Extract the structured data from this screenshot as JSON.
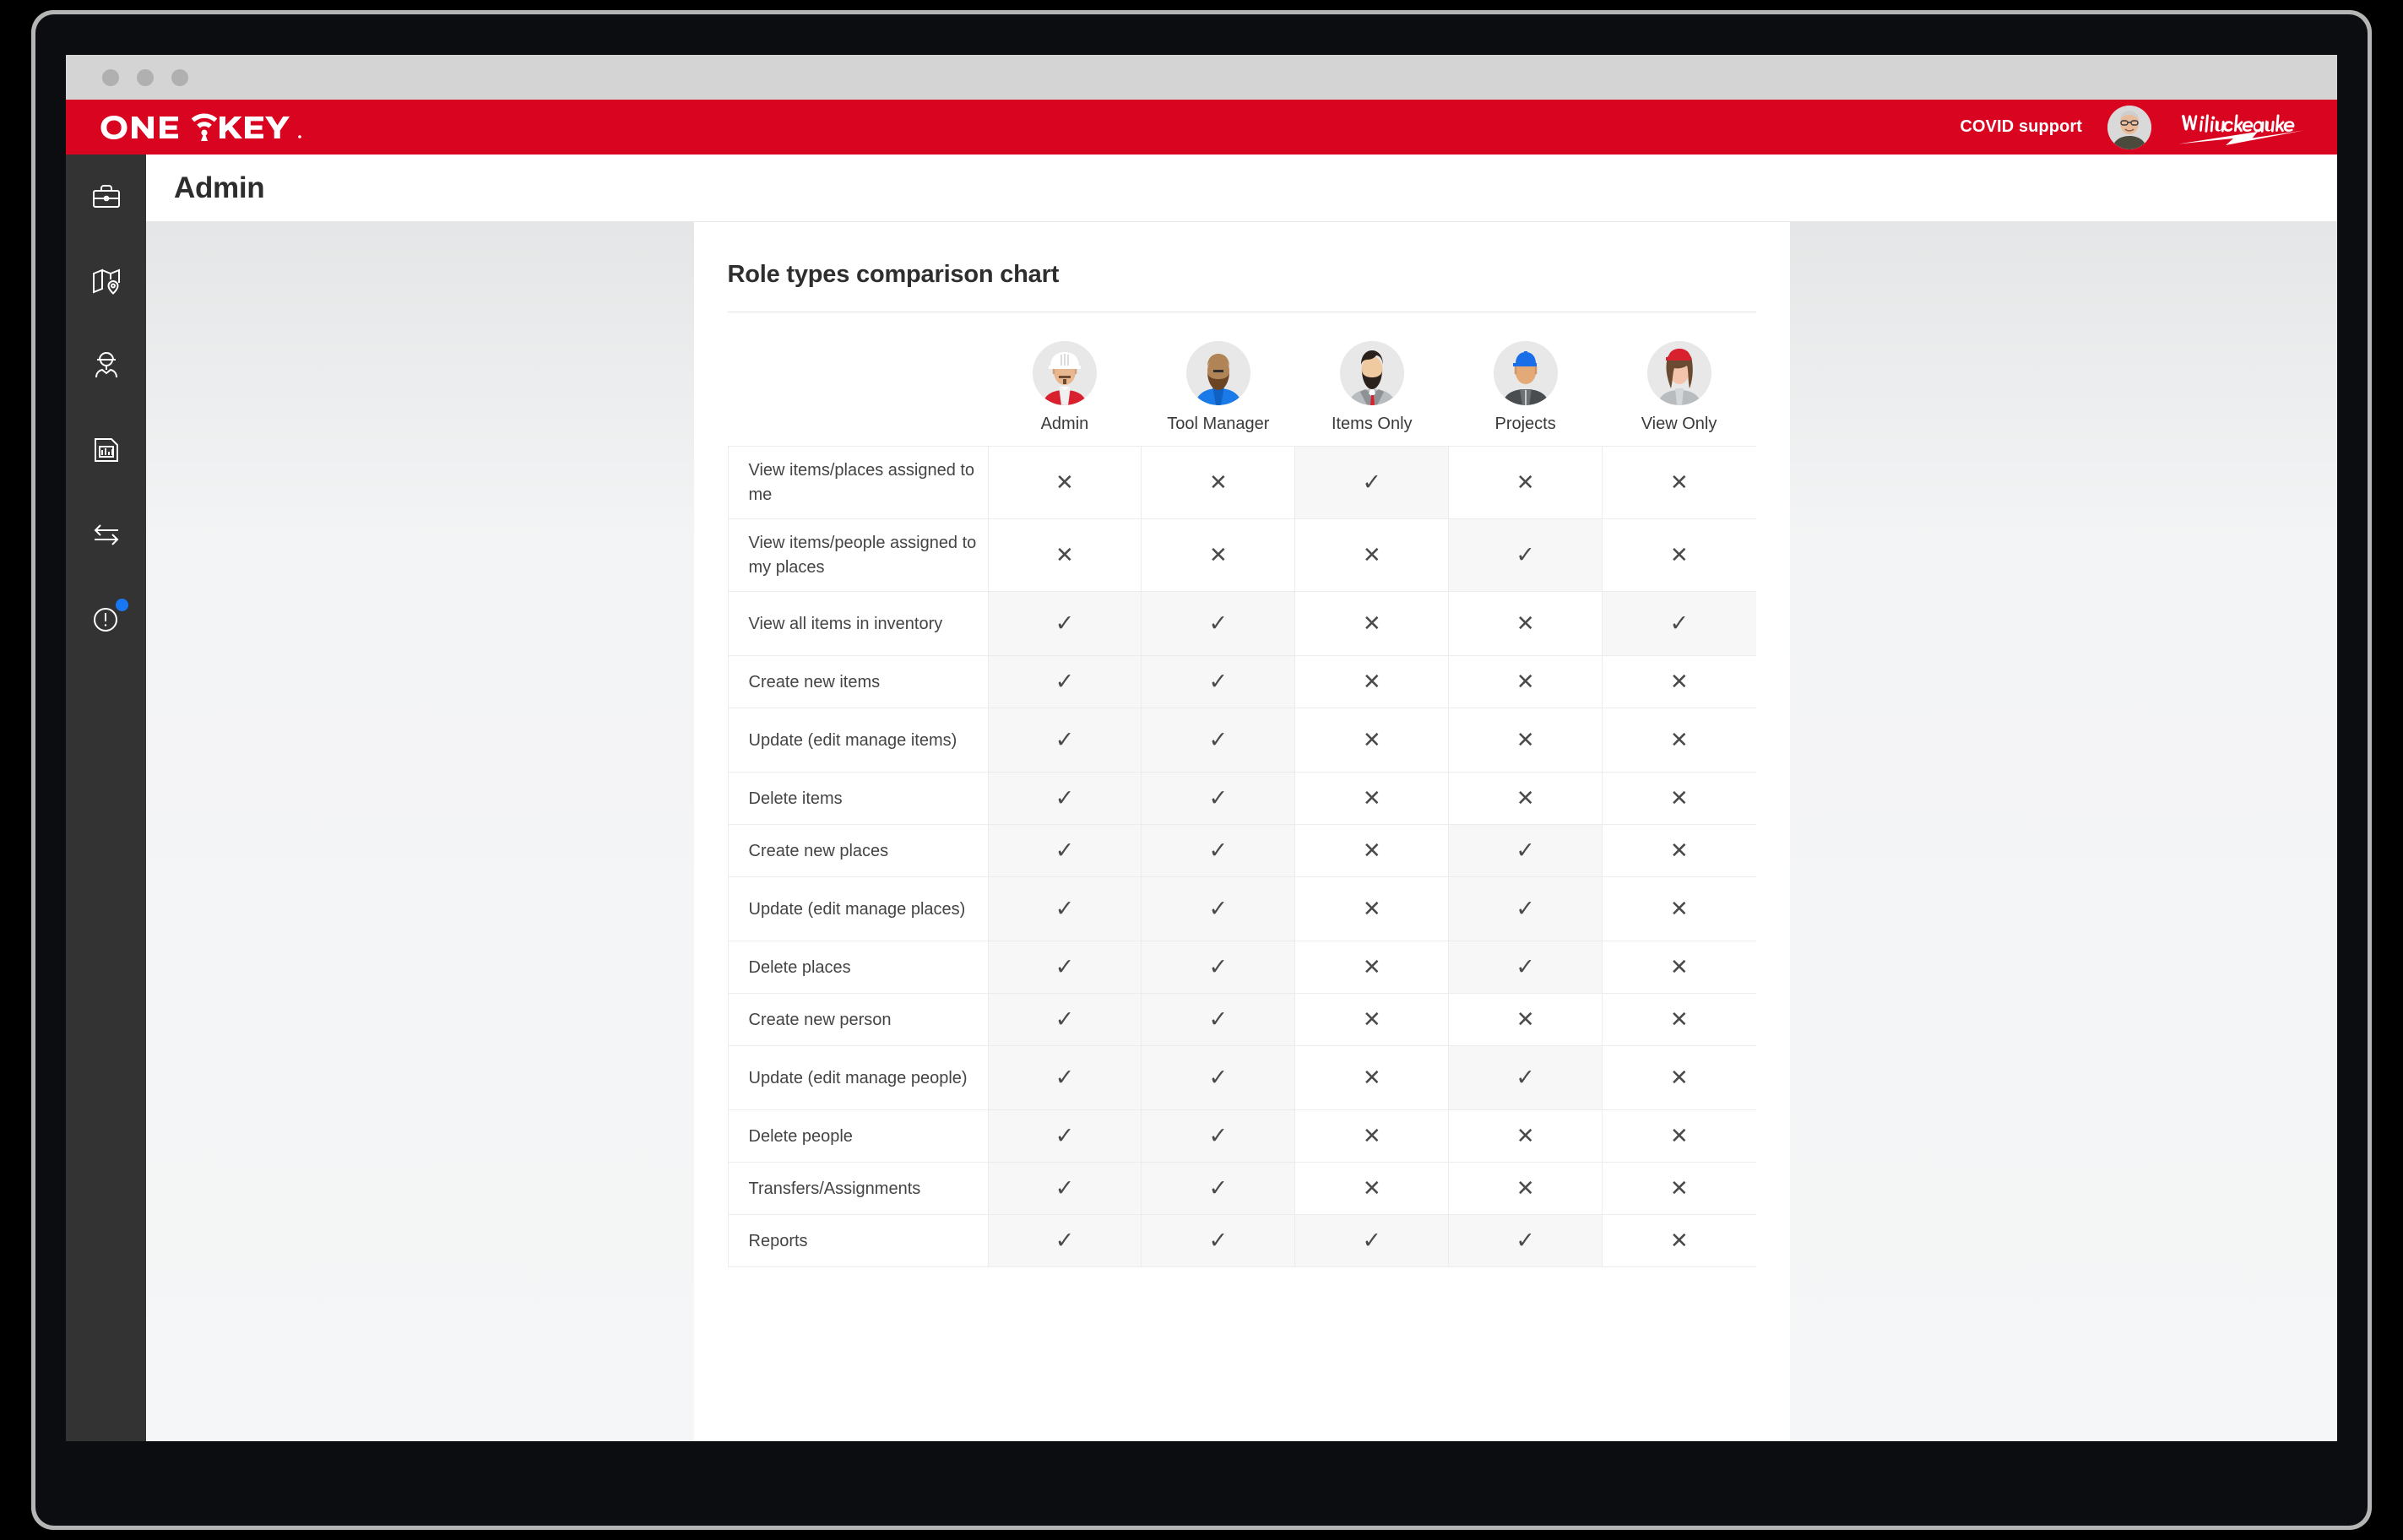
{
  "browser": {
    "dots": 3
  },
  "brand": {
    "logo_name": "ONE-KEY",
    "covid_label": "COVID support",
    "company_logo_name": "Milwaukee",
    "bar_color": "#d9041f"
  },
  "sidebar": {
    "items": [
      {
        "name": "toolbox",
        "icon": "toolbox-icon",
        "badge": false
      },
      {
        "name": "places",
        "icon": "map-pin-icon",
        "badge": false
      },
      {
        "name": "people",
        "icon": "worker-icon",
        "badge": false
      },
      {
        "name": "reports",
        "icon": "report-icon",
        "badge": false
      },
      {
        "name": "transfers",
        "icon": "transfer-icon",
        "badge": false
      },
      {
        "name": "alerts",
        "icon": "alert-icon",
        "badge": true
      }
    ]
  },
  "page": {
    "title": "Admin"
  },
  "card": {
    "title": "Role types comparison chart"
  },
  "chart_data": {
    "type": "table",
    "title": "Role types comparison chart",
    "columns": [
      {
        "label": "Admin",
        "avatar": "admin-avatar"
      },
      {
        "label": "Tool Manager",
        "avatar": "tool-manager-avatar"
      },
      {
        "label": "Items Only",
        "avatar": "items-only-avatar"
      },
      {
        "label": "Projects",
        "avatar": "projects-avatar"
      },
      {
        "label": "View Only",
        "avatar": "view-only-avatar"
      }
    ],
    "row_label_header": "",
    "marks": {
      "true": "✓",
      "false": "✕"
    },
    "rows": [
      {
        "label": "View items/places assigned to me",
        "values": [
          false,
          false,
          true,
          false,
          false
        ],
        "lines": 2
      },
      {
        "label": "View items/people assigned to my places",
        "values": [
          false,
          false,
          false,
          true,
          false
        ],
        "lines": 2
      },
      {
        "label": "View all items in inventory",
        "values": [
          true,
          true,
          false,
          false,
          true
        ],
        "lines": 2
      },
      {
        "label": "Create new items",
        "values": [
          true,
          true,
          false,
          false,
          false
        ],
        "lines": 1
      },
      {
        "label": "Update (edit manage items)",
        "values": [
          true,
          true,
          false,
          false,
          false
        ],
        "lines": 2
      },
      {
        "label": "Delete items",
        "values": [
          true,
          true,
          false,
          false,
          false
        ],
        "lines": 1
      },
      {
        "label": "Create new places",
        "values": [
          true,
          true,
          false,
          true,
          false
        ],
        "lines": 1
      },
      {
        "label": "Update (edit manage places)",
        "values": [
          true,
          true,
          false,
          true,
          false
        ],
        "lines": 2
      },
      {
        "label": "Delete places",
        "values": [
          true,
          true,
          false,
          true,
          false
        ],
        "lines": 1
      },
      {
        "label": "Create new person",
        "values": [
          true,
          true,
          false,
          false,
          false
        ],
        "lines": 1
      },
      {
        "label": "Update (edit manage people)",
        "values": [
          true,
          true,
          false,
          true,
          false
        ],
        "lines": 2
      },
      {
        "label": "Delete people",
        "values": [
          true,
          true,
          false,
          false,
          false
        ],
        "lines": 1
      },
      {
        "label": "Transfers/Assignments",
        "values": [
          true,
          true,
          false,
          false,
          false
        ],
        "lines": 1
      },
      {
        "label": "Reports",
        "values": [
          true,
          true,
          true,
          true,
          false
        ],
        "lines": 1
      }
    ]
  }
}
